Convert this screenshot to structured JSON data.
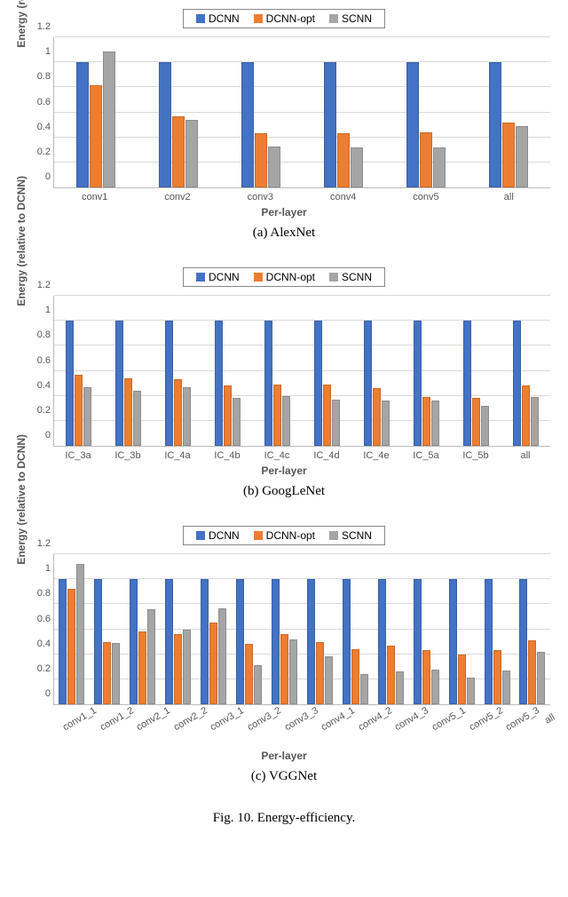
{
  "colors": {
    "dcnn": "#4472C4",
    "dcnn_opt": "#ED7D31",
    "scnn": "#A5A5A5"
  },
  "legend": {
    "dcnn": "DCNN",
    "dcnn_opt": "DCNN-opt",
    "scnn": "SCNN"
  },
  "axis": {
    "ylabel": "Energy (relative to DCNN)",
    "xlabel": "Per-layer"
  },
  "figure_caption": "Fig. 10.   Energy-efficiency.",
  "subcaptions": {
    "a": "(a) AlexNet",
    "b": "(b) GoogLeNet",
    "c": "(c) VGGNet"
  },
  "chart_data": [
    {
      "id": "alexnet",
      "type": "bar",
      "ylim": [
        0,
        1.2
      ],
      "yticks": [
        0,
        0.2,
        0.4,
        0.6,
        0.8,
        1,
        1.2
      ],
      "categories": [
        "conv1",
        "conv2",
        "conv3",
        "conv4",
        "conv5",
        "all"
      ],
      "series": [
        {
          "name": "DCNN",
          "values": [
            1.0,
            1.0,
            1.0,
            1.0,
            1.0,
            1.0
          ]
        },
        {
          "name": "DCNN-opt",
          "values": [
            0.82,
            0.57,
            0.43,
            0.43,
            0.44,
            0.52
          ]
        },
        {
          "name": "SCNN",
          "values": [
            1.09,
            0.54,
            0.33,
            0.32,
            0.32,
            0.49
          ]
        }
      ],
      "xlabel": "Per-layer",
      "ylabel": "Energy (relative to DCNN)"
    },
    {
      "id": "googlenet",
      "type": "bar",
      "ylim": [
        0,
        1.2
      ],
      "yticks": [
        0,
        0.2,
        0.4,
        0.6,
        0.8,
        1,
        1.2
      ],
      "categories": [
        "IC_3a",
        "IC_3b",
        "IC_4a",
        "IC_4b",
        "IC_4c",
        "IC_4d",
        "IC_4e",
        "IC_5a",
        "IC_5b",
        "all"
      ],
      "series": [
        {
          "name": "DCNN",
          "values": [
            1.0,
            1.0,
            1.0,
            1.0,
            1.0,
            1.0,
            1.0,
            1.0,
            1.0,
            1.0
          ]
        },
        {
          "name": "DCNN-opt",
          "values": [
            0.57,
            0.54,
            0.53,
            0.48,
            0.49,
            0.49,
            0.46,
            0.39,
            0.38,
            0.48
          ]
        },
        {
          "name": "SCNN",
          "values": [
            0.47,
            0.44,
            0.47,
            0.38,
            0.4,
            0.37,
            0.36,
            0.36,
            0.32,
            0.39
          ]
        }
      ],
      "xlabel": "Per-layer",
      "ylabel": "Energy (relative to DCNN)"
    },
    {
      "id": "vggnet",
      "type": "bar",
      "ylim": [
        0,
        1.2
      ],
      "yticks": [
        0,
        0.2,
        0.4,
        0.6,
        0.8,
        1,
        1.2
      ],
      "categories": [
        "conv1_1",
        "conv1_2",
        "conv2_1",
        "conv2_2",
        "conv3_1",
        "conv3_2",
        "conv3_3",
        "conv4_1",
        "conv4_2",
        "conv4_3",
        "conv5_1",
        "conv5_2",
        "conv5_3",
        "all"
      ],
      "series": [
        {
          "name": "DCNN",
          "values": [
            1.0,
            1.0,
            1.0,
            1.0,
            1.0,
            1.0,
            1.0,
            1.0,
            1.0,
            1.0,
            1.0,
            1.0,
            1.0,
            1.0
          ]
        },
        {
          "name": "DCNN-opt",
          "values": [
            0.92,
            0.5,
            0.58,
            0.56,
            0.65,
            0.48,
            0.56,
            0.5,
            0.44,
            0.47,
            0.43,
            0.4,
            0.43,
            0.51
          ]
        },
        {
          "name": "SCNN",
          "values": [
            1.12,
            0.49,
            0.76,
            0.6,
            0.77,
            0.31,
            0.52,
            0.38,
            0.24,
            0.26,
            0.28,
            0.21,
            0.27,
            0.42
          ]
        }
      ],
      "xlabel": "Per-layer",
      "ylabel": "Energy (relative to DCNN)"
    }
  ]
}
